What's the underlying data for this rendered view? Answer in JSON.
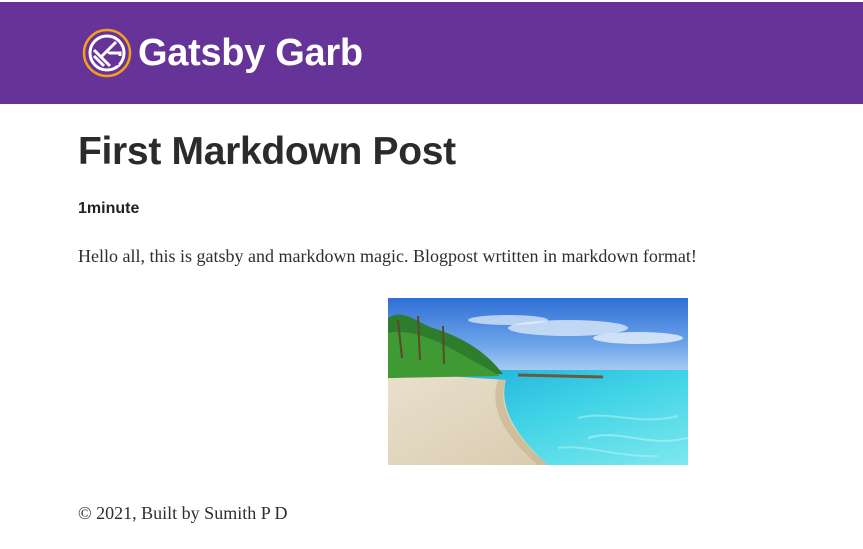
{
  "header": {
    "brand_name": "Gatsby Garb",
    "background_color": "#663399",
    "logo_icon": "gatsby-logo-icon"
  },
  "post": {
    "title": "First Markdown Post",
    "read_time": "1minute",
    "body": "Hello all, this is gatsby and markdown magic. Blogpost wrtitten in markdown format!",
    "image_subject": "tropical-beach-photo"
  },
  "footer": {
    "text": "© 2021, Built by Sumith P D"
  }
}
